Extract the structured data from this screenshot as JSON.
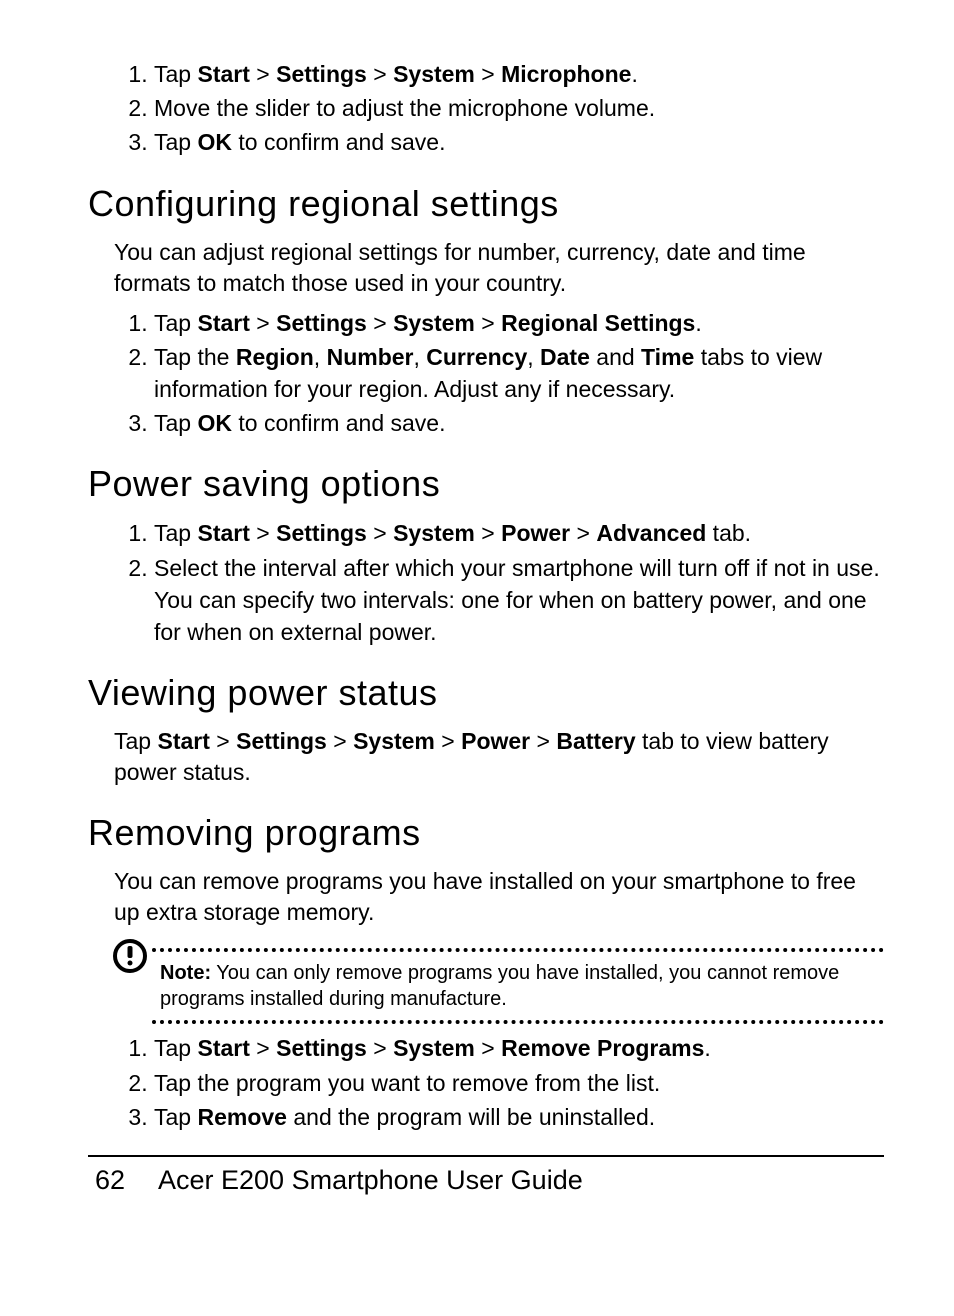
{
  "intro_list": [
    [
      {
        "t": "Tap "
      },
      {
        "t": "Start",
        "b": true
      },
      {
        "t": " > "
      },
      {
        "t": "Settings",
        "b": true
      },
      {
        "t": " > "
      },
      {
        "t": "System",
        "b": true
      },
      {
        "t": " > "
      },
      {
        "t": "Microphone",
        "b": true
      },
      {
        "t": "."
      }
    ],
    [
      {
        "t": "Move the slider to adjust the microphone volume."
      }
    ],
    [
      {
        "t": "Tap "
      },
      {
        "t": "OK",
        "b": true
      },
      {
        "t": " to confirm and save."
      }
    ]
  ],
  "h_regional": "Configuring regional settings",
  "p_regional": "You can adjust regional settings for number, currency, date and time formats to match those used in your country.",
  "regional_list": [
    [
      {
        "t": "Tap "
      },
      {
        "t": "Start",
        "b": true
      },
      {
        "t": " > "
      },
      {
        "t": "Settings",
        "b": true
      },
      {
        "t": " > "
      },
      {
        "t": "System",
        "b": true
      },
      {
        "t": " > "
      },
      {
        "t": "Regional Settings",
        "b": true
      },
      {
        "t": "."
      }
    ],
    [
      {
        "t": "Tap the "
      },
      {
        "t": "Region",
        "b": true
      },
      {
        "t": ", "
      },
      {
        "t": "Number",
        "b": true
      },
      {
        "t": ", "
      },
      {
        "t": "Currency",
        "b": true
      },
      {
        "t": ", "
      },
      {
        "t": "Date",
        "b": true
      },
      {
        "t": " and "
      },
      {
        "t": "Time",
        "b": true
      },
      {
        "t": " tabs to view information for your region. Adjust any if necessary."
      }
    ],
    [
      {
        "t": "Tap "
      },
      {
        "t": "OK",
        "b": true
      },
      {
        "t": " to confirm and save."
      }
    ]
  ],
  "h_power": "Power saving options",
  "power_list": [
    [
      {
        "t": "Tap "
      },
      {
        "t": "Start",
        "b": true
      },
      {
        "t": " > "
      },
      {
        "t": "Settings",
        "b": true
      },
      {
        "t": " > "
      },
      {
        "t": "System",
        "b": true
      },
      {
        "t": " > "
      },
      {
        "t": "Power",
        "b": true
      },
      {
        "t": " > "
      },
      {
        "t": "Advanced",
        "b": true
      },
      {
        "t": " tab."
      }
    ],
    [
      {
        "t": "Select the interval after which your smartphone will turn off if not in use. You can specify two intervals: one for when on battery power, and one for when on external power."
      }
    ]
  ],
  "h_viewing": "Viewing power status",
  "p_viewing": [
    {
      "t": "Tap "
    },
    {
      "t": "Start",
      "b": true
    },
    {
      "t": " > "
    },
    {
      "t": "Settings",
      "b": true
    },
    {
      "t": " > "
    },
    {
      "t": "System",
      "b": true
    },
    {
      "t": " > "
    },
    {
      "t": "Power",
      "b": true
    },
    {
      "t": " > "
    },
    {
      "t": "Battery",
      "b": true
    },
    {
      "t": " tab to view battery power status."
    }
  ],
  "h_removing": "Removing programs",
  "p_removing": "You can remove programs you have installed on your smartphone to free up extra storage memory.",
  "note": [
    {
      "t": "Note:",
      "b": true
    },
    {
      "t": " You can only remove programs you have installed, you cannot remove programs installed during manufacture."
    }
  ],
  "removing_list": [
    [
      {
        "t": "Tap "
      },
      {
        "t": "Start",
        "b": true
      },
      {
        "t": " > "
      },
      {
        "t": "Settings",
        "b": true
      },
      {
        "t": " > "
      },
      {
        "t": "System",
        "b": true
      },
      {
        "t": " > "
      },
      {
        "t": "Remove Programs",
        "b": true
      },
      {
        "t": "."
      }
    ],
    [
      {
        "t": "Tap the program you want to remove from the list."
      }
    ],
    [
      {
        "t": "Tap "
      },
      {
        "t": "Remove",
        "b": true
      },
      {
        "t": " and the program will be uninstalled."
      }
    ]
  ],
  "footer_page": "62",
  "footer_title": "Acer E200 Smartphone User Guide"
}
